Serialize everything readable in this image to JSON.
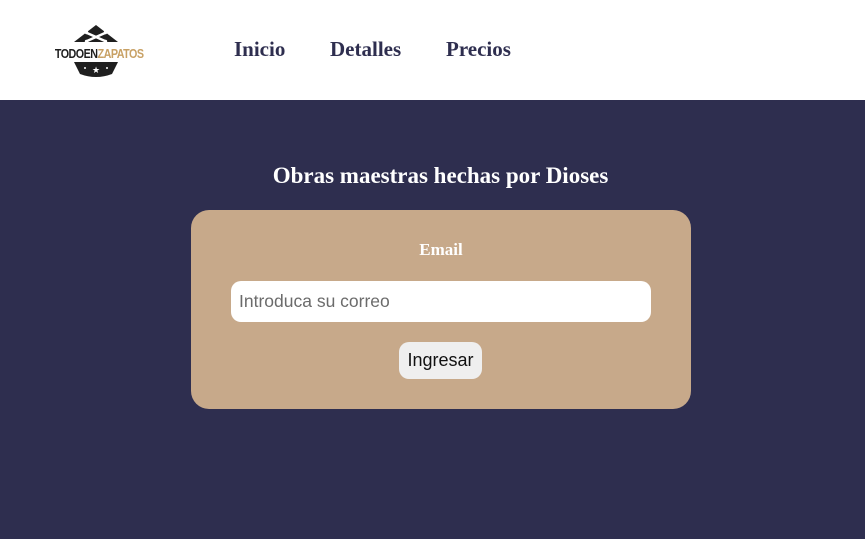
{
  "header": {
    "logo": {
      "word1": "TODOEN",
      "word2": "ZAPATOS",
      "icon": "crossed-bones-star-badge-icon"
    },
    "nav": [
      {
        "label": "Inicio"
      },
      {
        "label": "Detalles"
      },
      {
        "label": "Precios"
      }
    ]
  },
  "hero": {
    "title": "Obras maestras hechas por Dioses"
  },
  "form": {
    "label": "Email",
    "email_placeholder": "Introduca su correo",
    "email_value": "",
    "submit_label": "Ingresar"
  },
  "colors": {
    "header_bg": "#ffffff",
    "page_bg": "#2e2e4f",
    "nav_text": "#2e2e4f",
    "card_bg": "#c7a98a",
    "logo_accent": "#c8a165"
  }
}
